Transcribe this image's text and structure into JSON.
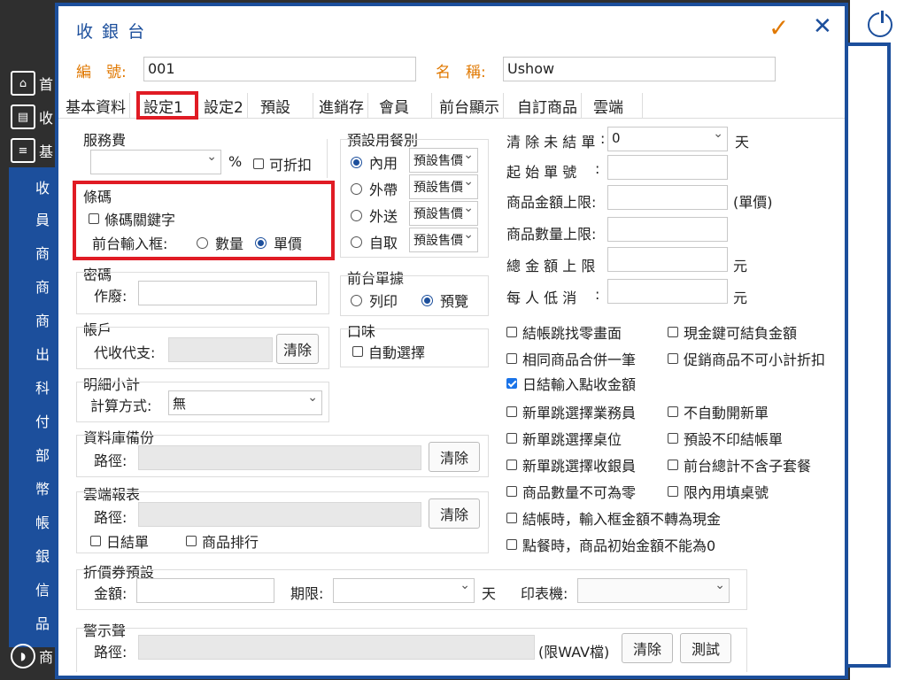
{
  "sidebar": {
    "top_items": [
      {
        "label": "首"
      },
      {
        "label": "收"
      },
      {
        "label": "基"
      }
    ],
    "items": [
      {
        "label": "收"
      },
      {
        "label": "員"
      },
      {
        "label": "商"
      },
      {
        "label": "商"
      },
      {
        "label": "商"
      },
      {
        "label": "出"
      },
      {
        "label": "科"
      },
      {
        "label": "付"
      },
      {
        "label": "部"
      },
      {
        "label": "幣"
      },
      {
        "label": "帳"
      },
      {
        "label": "銀"
      },
      {
        "label": "信"
      },
      {
        "label": "品"
      }
    ],
    "bottom_label": "商"
  },
  "dialog": {
    "title": "收 銀 台",
    "confirm_symbol": "✓",
    "close_symbol": "✕",
    "code_label": "編　號:",
    "code_value": "001",
    "name_label": "名　稱:",
    "name_value": "Ushow"
  },
  "tabs": [
    "基本資料",
    "設定1",
    "設定2",
    "預設",
    "進銷存",
    "會員",
    "前台顯示",
    "自訂商品",
    "雲端"
  ],
  "service_fee": {
    "title": "服務費",
    "unit": "%",
    "discountable": "可折扣",
    "value": ""
  },
  "barcode": {
    "title": "條碼",
    "keyword": "條碼關鍵字",
    "input_label": "前台輸入框:",
    "opt_qty": "數量",
    "opt_price": "單價"
  },
  "password": {
    "title": "密碼",
    "void_label": "作廢:"
  },
  "account": {
    "title": "帳戶",
    "collect_label": "代收代支:",
    "clear": "清除"
  },
  "subtotal": {
    "title": "明細小計",
    "method_label": "計算方式:",
    "method_value": "無"
  },
  "db_backup": {
    "title": "資料庫備份",
    "path_label": "路徑:",
    "clear": "清除"
  },
  "cloud_report": {
    "title": "雲端報表",
    "path_label": "路徑:",
    "clear": "清除",
    "daily": "日結單",
    "ranking": "商品排行"
  },
  "default_meal": {
    "title": "預設用餐別",
    "options": [
      {
        "label": "內用",
        "select": "預設售價"
      },
      {
        "label": "外帶",
        "select": "預設售價"
      },
      {
        "label": "外送",
        "select": "預設售價"
      },
      {
        "label": "自取",
        "select": "預設售價"
      }
    ]
  },
  "front_doc": {
    "title": "前台單據",
    "print": "列印",
    "preview": "預覽"
  },
  "taste": {
    "title": "口味",
    "auto": "自動選擇"
  },
  "right_fields": {
    "clear_unsettled": "清 除 未 結 單",
    "clear_unsettled_value": "0",
    "clear_unsettled_unit": "天",
    "start_no": "起 始 單 號",
    "price_limit": "商品金額上限:",
    "price_limit_unit": "(單價)",
    "qty_limit": "商品數量上限:",
    "total_limit": "總 金 額 上 限",
    "total_unit": "元",
    "min_spend": "每 人 低 消",
    "min_unit": "元"
  },
  "checkboxes_left": [
    {
      "label": "結帳跳找零畫面",
      "checked": false
    },
    {
      "label": "相同商品合併一筆",
      "checked": false
    },
    {
      "label": "日結輸入點收金額",
      "checked": true
    },
    {
      "label": "新單跳選擇業務員",
      "checked": false
    },
    {
      "label": "新單跳選擇桌位",
      "checked": false
    },
    {
      "label": "新單跳選擇收銀員",
      "checked": false
    },
    {
      "label": "商品數量不可為零",
      "checked": false
    },
    {
      "label": "結帳時，輸入框金額不轉為現金",
      "checked": false
    },
    {
      "label": "點餐時，商品初始金額不能為0",
      "checked": false
    }
  ],
  "checkboxes_right": [
    {
      "label": "現金鍵可結負金額",
      "checked": false
    },
    {
      "label": "促銷商品不可小計折扣",
      "checked": false
    },
    {
      "label": "不自動開新單",
      "checked": false
    },
    {
      "label": "預設不印結帳單",
      "checked": false
    },
    {
      "label": "前台總計不含子套餐",
      "checked": false
    },
    {
      "label": "限內用填桌號",
      "checked": false
    }
  ],
  "coupon": {
    "title": "折價券預設",
    "amount_label": "金額:",
    "period_label": "期限:",
    "period_unit": "天",
    "printer_label": "印表機:"
  },
  "alert_sound": {
    "title": "警示聲",
    "path_label": "路徑:",
    "hint": "(限WAV檔)",
    "clear": "清除",
    "test": "測試"
  },
  "colors": {
    "brand": "#1c4f9c",
    "orange": "#e07800",
    "highlight": "#e01b24",
    "check": "#1a73e8"
  }
}
